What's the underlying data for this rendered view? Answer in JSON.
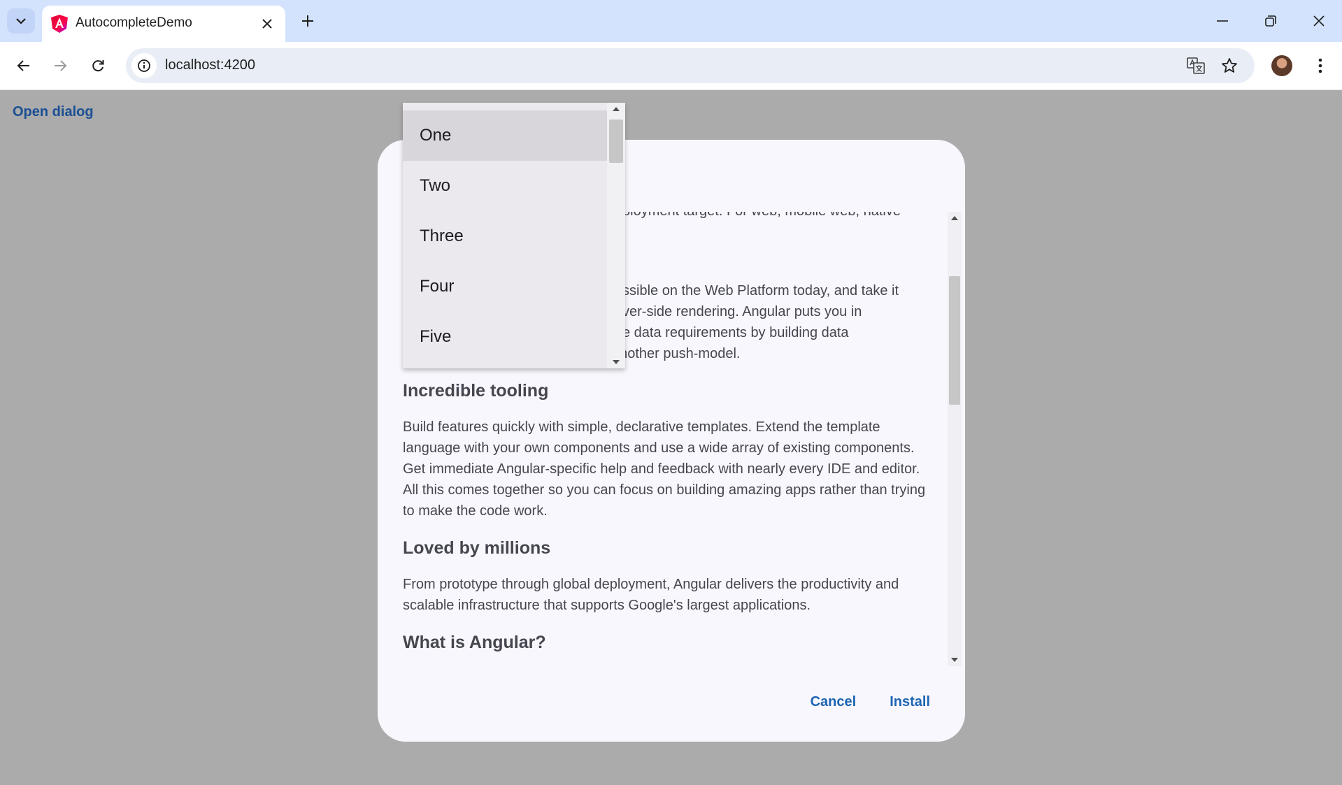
{
  "browser": {
    "tab_title": "AutocompleteDemo",
    "url": "localhost:4200",
    "icons": [
      "tab-search-icon",
      "angular-favicon",
      "close-icon",
      "plus-icon",
      "minimize-icon",
      "restore-icon",
      "window-close-icon",
      "back-arrow-icon",
      "forward-arrow-icon",
      "reload-icon",
      "info-icon",
      "translate-icon",
      "star-icon",
      "avatar",
      "kebab-menu-icon"
    ]
  },
  "page": {
    "open_dialog_label": "Open dialog"
  },
  "dialog": {
    "partial_top_line": "ployment target. For web, mobile web, native",
    "para_cut_lines": [
      "ssible on the Web Platform today, and take it",
      "ver-side rendering. Angular puts you in",
      "e data requirements by building data",
      "models on RxJS, Immutable.js or another push-model."
    ],
    "heading_tooling": "Incredible tooling",
    "para_tooling": "Build features quickly with simple, declarative templates. Extend the template language with your own components and use a wide array of existing components. Get immediate Angular-specific help and feedback with nearly every IDE and editor. All this comes together so you can focus on building amazing apps rather than trying to make the code work.",
    "heading_loved": "Loved by millions",
    "para_loved": "From prototype through global deployment, Angular delivers the productivity and scalable infrastructure that supports Google's largest applications.",
    "heading_what": "What is Angular?",
    "cancel_label": "Cancel",
    "install_label": "Install"
  },
  "autocomplete": {
    "options": [
      "One",
      "Two",
      "Three",
      "Four",
      "Five"
    ],
    "active_option": "One"
  },
  "colors": {
    "tabstrip": "#d3e3fd",
    "backdrop": "#ababab",
    "dialog_surface": "#f8f7fd",
    "link": "#1a4f93",
    "action": "#1d64b3",
    "panel": "#ece9ee",
    "option_active": "#d8d5db"
  }
}
